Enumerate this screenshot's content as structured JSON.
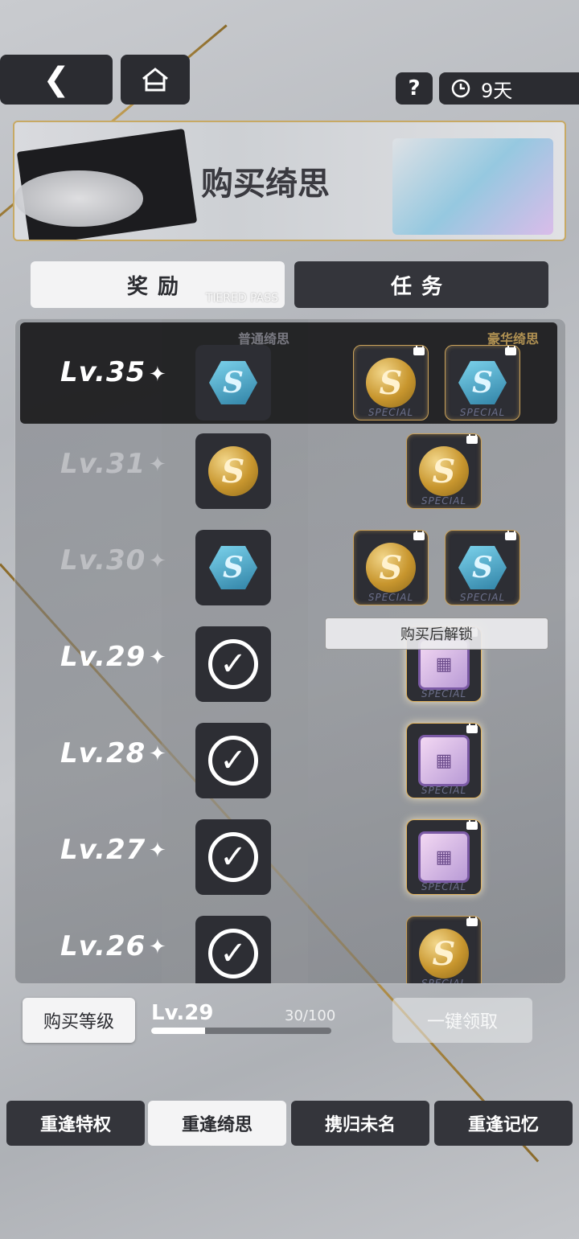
{
  "header": {
    "back_icon": "chevron-left-icon",
    "home_icon": "home-icon",
    "help_label": "?",
    "timer_icon": "clock-icon",
    "timer_text": "9天"
  },
  "banner": {
    "title": "购买绮思"
  },
  "tabs": {
    "rewards": "奖励",
    "tasks": "任务",
    "watermark": "TIERED PASS"
  },
  "columns": {
    "free": "普通绮思",
    "premium": "豪华绮思"
  },
  "rows": [
    {
      "level": "Lv.35",
      "free": "hex",
      "premium": [
        "coin",
        "hex"
      ],
      "claimed": false,
      "highlight": true
    },
    {
      "level": "Lv.31",
      "free": "coin",
      "premium": [
        "coin"
      ],
      "claimed": false
    },
    {
      "level": "Lv.30",
      "free": "hex",
      "premium": [
        "coin",
        "hex"
      ],
      "claimed": false
    },
    {
      "level": "Lv.29",
      "free": "check",
      "premium": [
        "chip"
      ],
      "claimed": true
    },
    {
      "level": "Lv.28",
      "free": "check",
      "premium": [
        "chip"
      ],
      "claimed": true
    },
    {
      "level": "Lv.27",
      "free": "check",
      "premium": [
        "chip"
      ],
      "claimed": true
    },
    {
      "level": "Lv.26",
      "free": "check",
      "premium": [
        "coin"
      ],
      "claimed": true
    }
  ],
  "special_label": "SPECIAL",
  "coin_glyph": "S",
  "unlock_tooltip": "购买后解锁",
  "progress": {
    "buy_level": "购买等级",
    "level": "Lv.29",
    "value": "30/100",
    "fraction": 0.3,
    "claim_all": "一键领取"
  },
  "bottom_tabs": [
    "重逢特权",
    "重逢绮思",
    "携归未名",
    "重逢记忆"
  ],
  "colors": {
    "gold": "#c9a55a",
    "dark": "#2b2c31"
  }
}
